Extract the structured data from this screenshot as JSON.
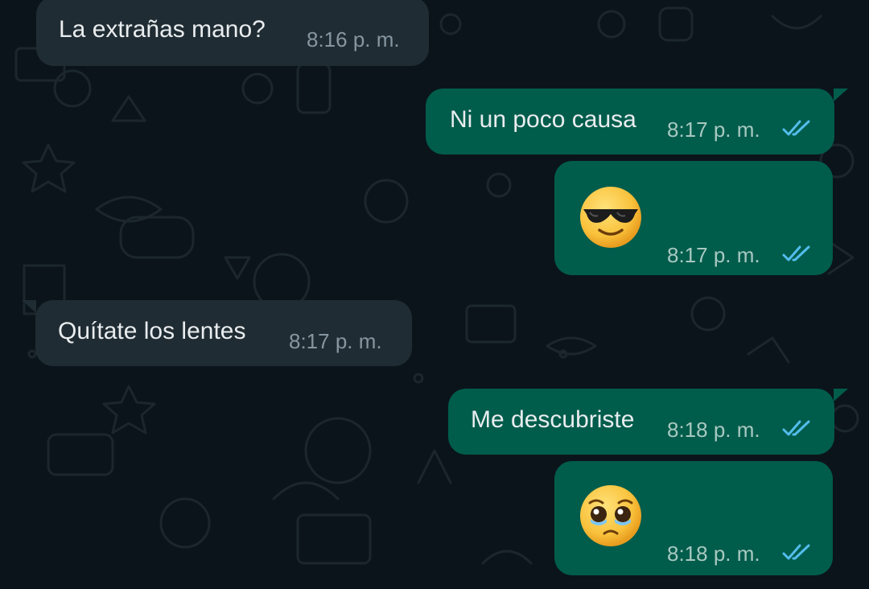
{
  "colors": {
    "background": "#0b141a",
    "incoming_bubble": "#202c33",
    "outgoing_bubble": "#005c4b",
    "text": "#e9edef",
    "time_incoming": "#8696a0",
    "time_outgoing": "#a8c9c1",
    "read_ticks": "#53bdeb"
  },
  "messages": [
    {
      "direction": "incoming",
      "text": "La extrañas mano?",
      "time": "8:16 p. m."
    },
    {
      "direction": "outgoing",
      "text": "Ni un poco causa",
      "time": "8:17 p. m.",
      "status": "read",
      "status_icon": "double-check-icon"
    },
    {
      "direction": "outgoing",
      "emoji": "smiling-face-with-sunglasses",
      "time": "8:17 p. m.",
      "status": "read",
      "status_icon": "double-check-icon"
    },
    {
      "direction": "incoming",
      "text": "Quítate los lentes",
      "time": "8:17 p. m."
    },
    {
      "direction": "outgoing",
      "text": "Me descubriste",
      "time": "8:18 p. m.",
      "status": "read",
      "status_icon": "double-check-icon"
    },
    {
      "direction": "outgoing",
      "emoji": "face-holding-back-tears",
      "time": "8:18 p. m.",
      "status": "read",
      "status_icon": "double-check-icon"
    }
  ]
}
